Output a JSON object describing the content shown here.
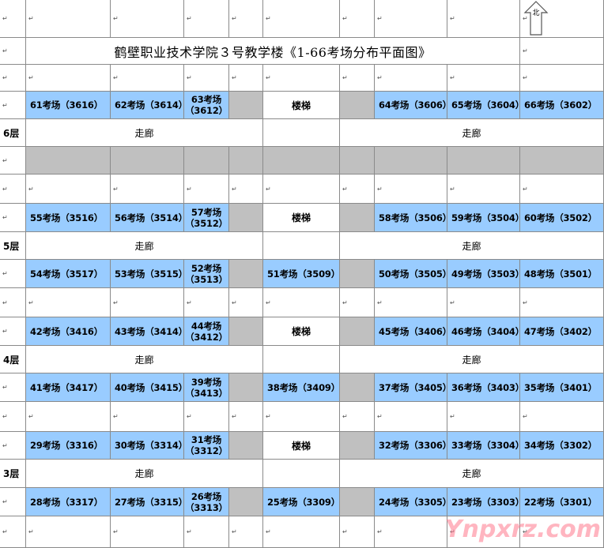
{
  "title": "鹤壁职业技术学院３号教学楼《1-66考场分布平面图》",
  "north_label": "北",
  "para_mark": "↵",
  "corridor_label": "走廊",
  "stairs_label": "楼梯",
  "watermark": "Ynpxrz.com",
  "floors": {
    "f6": {
      "label": "6层",
      "top": [
        "61考场（3616）",
        "62考场（3614）",
        "63考场（3612）",
        "",
        "楼梯",
        "",
        "64考场（3606）",
        "65考场（3604）",
        "66考场（3602）"
      ]
    },
    "f5": {
      "label": "5层",
      "top": [
        "55考场（3516）",
        "56考场（3514）",
        "57考场（3512）",
        "",
        "楼梯",
        "",
        "58考场（3506）",
        "59考场（3504）",
        "60考场（3502）"
      ],
      "bottom": [
        "54考场（3517）",
        "53考场（3515）",
        "52考场（3513）",
        "",
        "51考场（3509）",
        "",
        "50考场（3505）",
        "49考场（3503）",
        "48考场（3501）"
      ]
    },
    "f4": {
      "label": "4层",
      "top": [
        "42考场（3416）",
        "43考场（3414）",
        "44考场（3412）",
        "",
        "楼梯",
        "",
        "45考场（3406）",
        "46考场（3404）",
        "47考场（3402）"
      ],
      "bottom": [
        "41考场（3417）",
        "40考场（3415）",
        "39考场（3413）",
        "",
        "38考场（3409）",
        "",
        "37考场（3405）",
        "36考场（3403）",
        "35考场（3401）"
      ]
    },
    "f3": {
      "label": "3层",
      "top": [
        "29考场（3316）",
        "30考场（3314）",
        "31考场（3312）",
        "",
        "楼梯",
        "",
        "32考场（3306）",
        "33考场（3304）",
        "34考场（3302）"
      ],
      "bottom": [
        "28考场（3317）",
        "27考场（3315）",
        "26考场（3313）",
        "",
        "25考场（3309）",
        "",
        "24考场（3305）",
        "23考场（3303）",
        "22考场（3301）"
      ]
    }
  }
}
